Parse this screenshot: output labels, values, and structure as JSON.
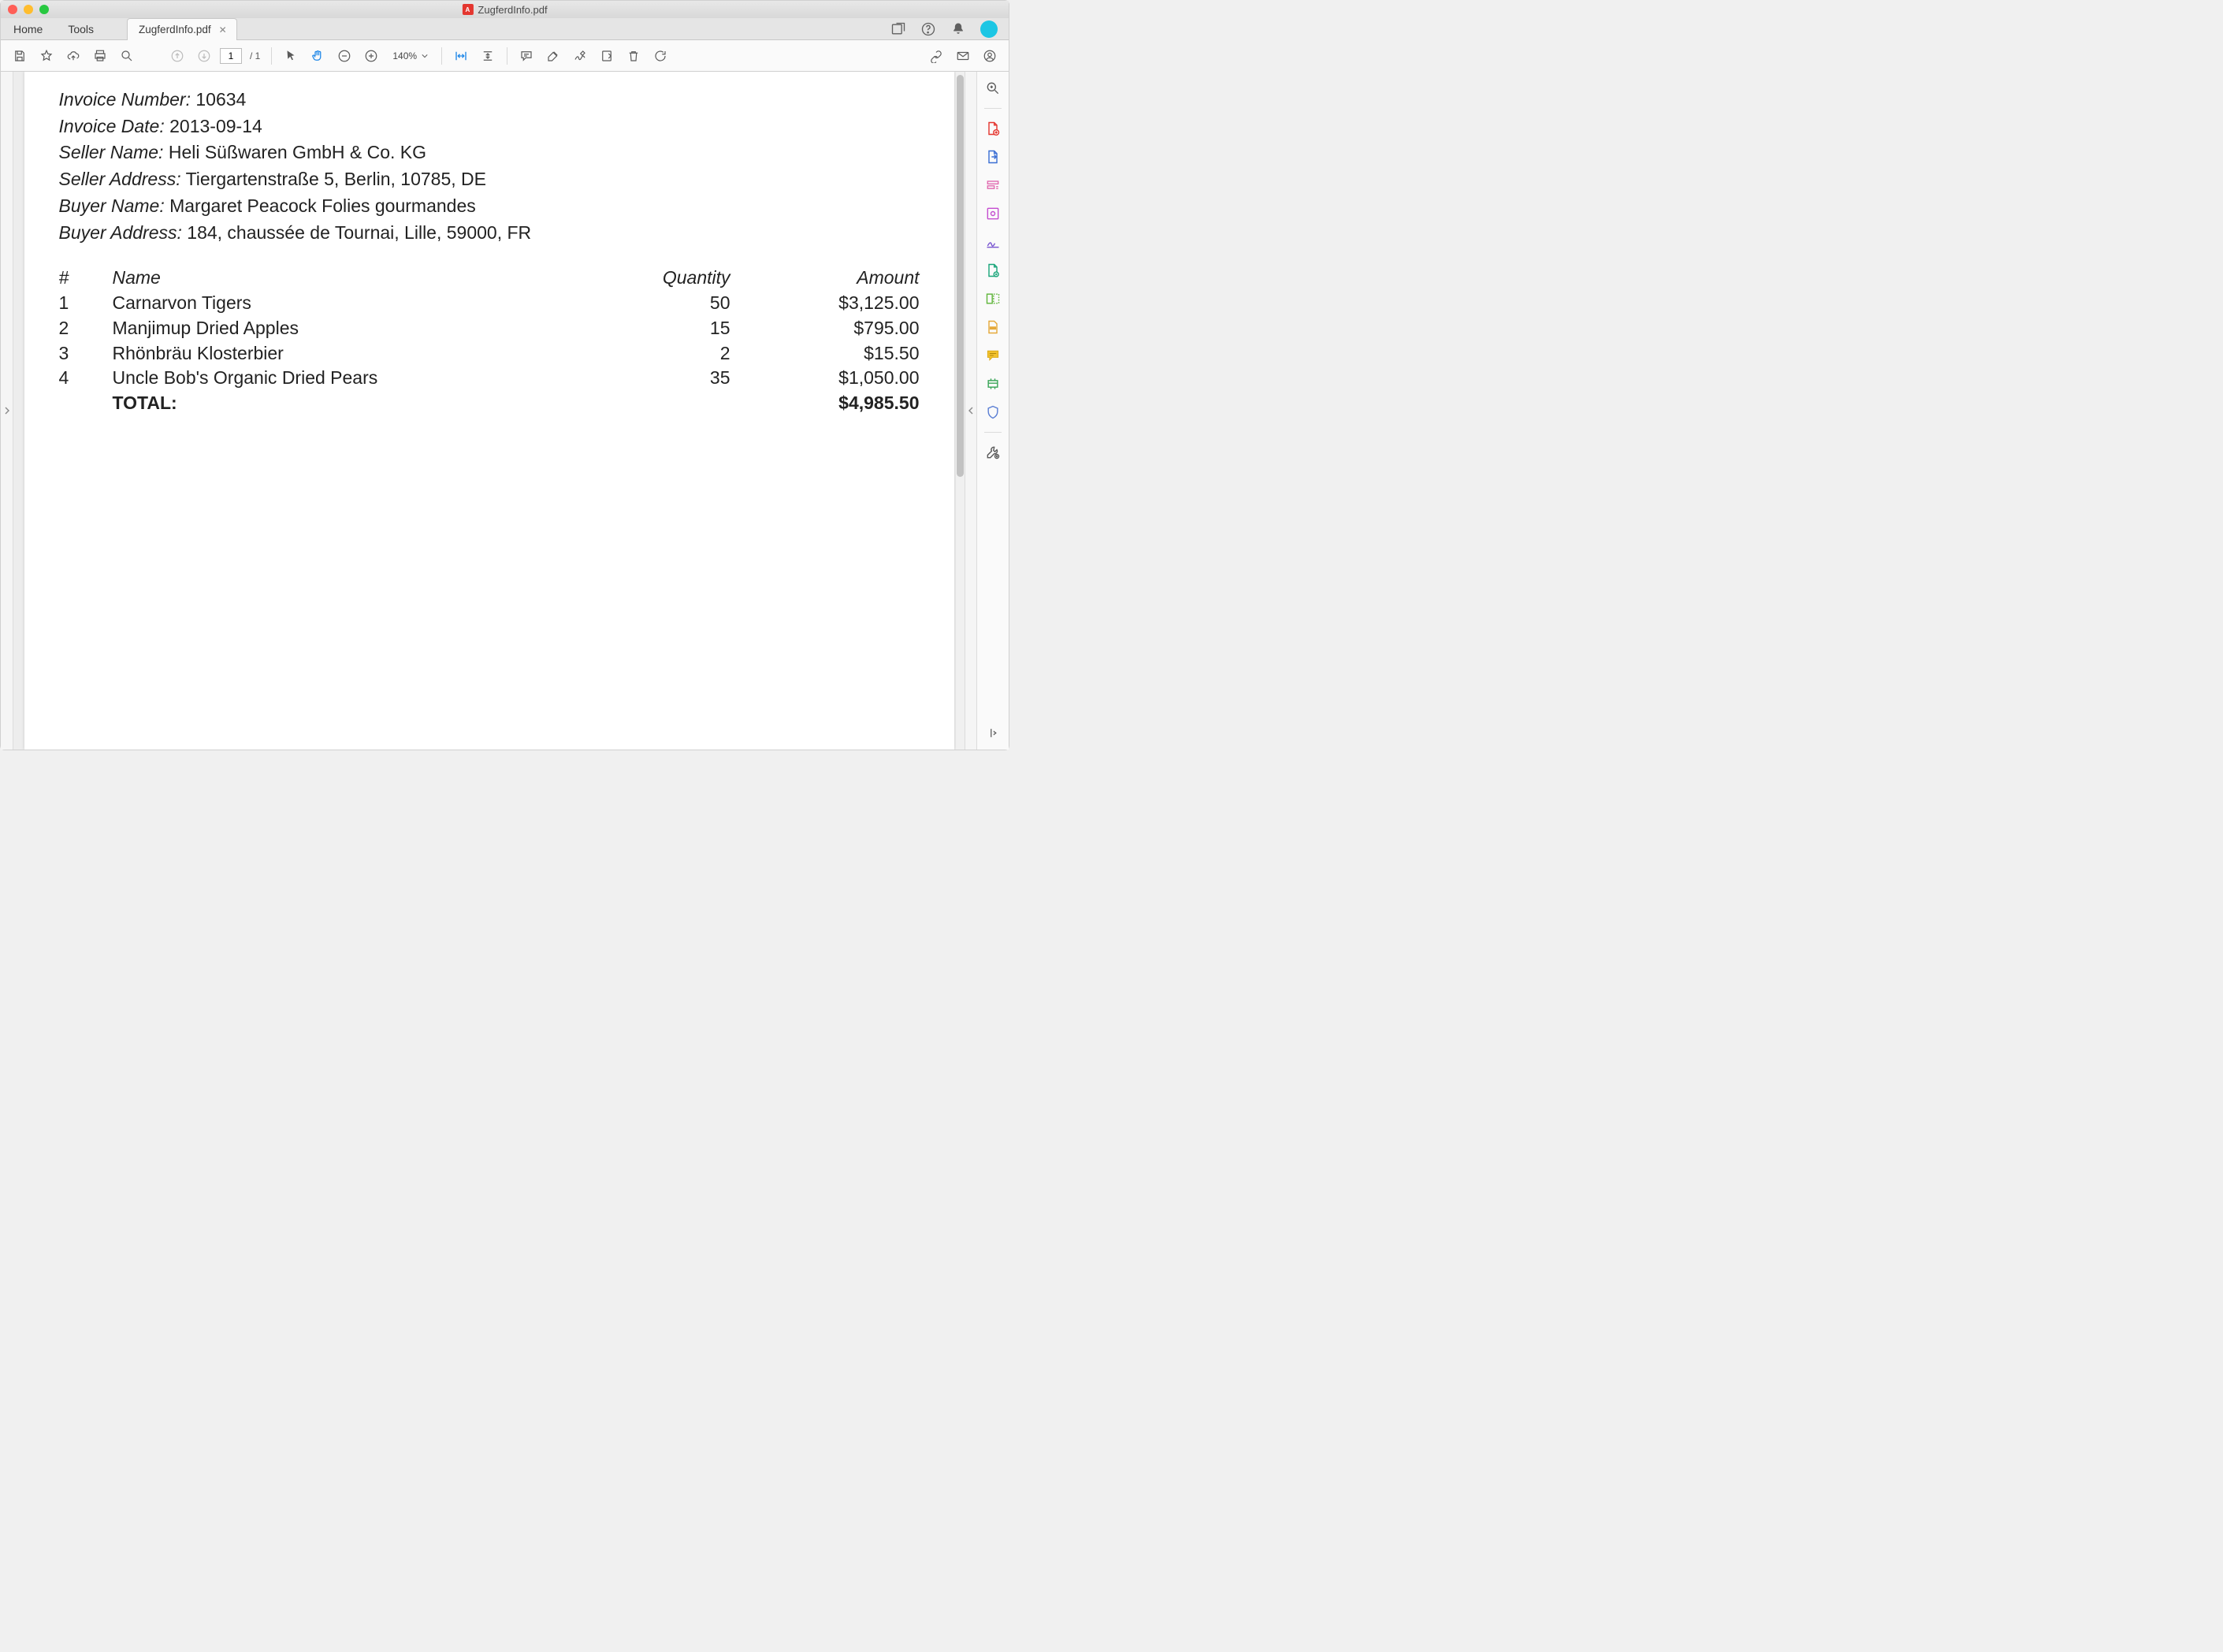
{
  "window": {
    "title": "ZugferdInfo.pdf"
  },
  "tabs": {
    "home": "Home",
    "tools": "Tools",
    "doc_title": "ZugferdInfo.pdf"
  },
  "toolbar": {
    "page_current": "1",
    "page_total": "/ 1",
    "zoom": "140%"
  },
  "invoice": {
    "labels": {
      "number": "Invoice Number:",
      "date": "Invoice Date:",
      "seller_name": "Seller Name:",
      "seller_addr": "Seller Address:",
      "buyer_name": "Buyer Name:",
      "buyer_addr": "Buyer Address:"
    },
    "number": "10634",
    "date": "2013-09-14",
    "seller_name": "Heli Süßwaren GmbH & Co. KG",
    "seller_addr": "Tiergartenstraße 5, Berlin, 10785, DE",
    "buyer_name": "Margaret Peacock Folies gourmandes",
    "buyer_addr": "184, chaussée de Tournai, Lille, 59000, FR",
    "table": {
      "headers": {
        "num": "#",
        "name": "Name",
        "qty": "Quantity",
        "amt": "Amount"
      },
      "rows": [
        {
          "num": "1",
          "name": "Carnarvon Tigers",
          "qty": "50",
          "amt": "$3,125.00"
        },
        {
          "num": "2",
          "name": "Manjimup Dried Apples",
          "qty": "15",
          "amt": "$795.00"
        },
        {
          "num": "3",
          "name": "Rhönbräu Klosterbier",
          "qty": "2",
          "amt": "$15.50"
        },
        {
          "num": "4",
          "name": "Uncle Bob's Organic Dried Pears",
          "qty": "35",
          "amt": "$1,050.00"
        }
      ],
      "total_label": "TOTAL:",
      "total_amt": "$4,985.50"
    }
  }
}
